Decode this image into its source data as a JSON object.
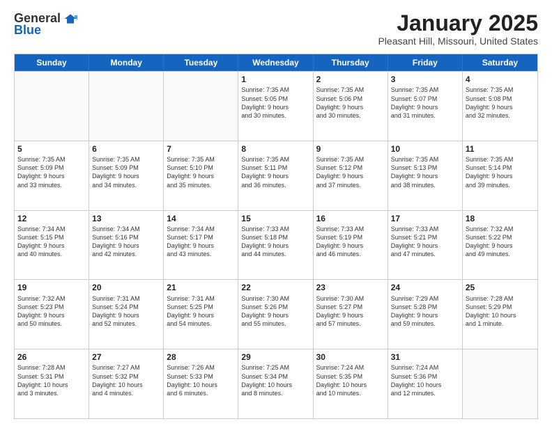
{
  "logo": {
    "general": "General",
    "blue": "Blue"
  },
  "title": "January 2025",
  "subtitle": "Pleasant Hill, Missouri, United States",
  "days": [
    "Sunday",
    "Monday",
    "Tuesday",
    "Wednesday",
    "Thursday",
    "Friday",
    "Saturday"
  ],
  "weeks": [
    [
      {
        "day": "",
        "info": "",
        "empty": true
      },
      {
        "day": "",
        "info": "",
        "empty": true
      },
      {
        "day": "",
        "info": "",
        "empty": true
      },
      {
        "day": "1",
        "info": "Sunrise: 7:35 AM\nSunset: 5:05 PM\nDaylight: 9 hours\nand 30 minutes."
      },
      {
        "day": "2",
        "info": "Sunrise: 7:35 AM\nSunset: 5:06 PM\nDaylight: 9 hours\nand 30 minutes."
      },
      {
        "day": "3",
        "info": "Sunrise: 7:35 AM\nSunset: 5:07 PM\nDaylight: 9 hours\nand 31 minutes."
      },
      {
        "day": "4",
        "info": "Sunrise: 7:35 AM\nSunset: 5:08 PM\nDaylight: 9 hours\nand 32 minutes."
      }
    ],
    [
      {
        "day": "5",
        "info": "Sunrise: 7:35 AM\nSunset: 5:09 PM\nDaylight: 9 hours\nand 33 minutes."
      },
      {
        "day": "6",
        "info": "Sunrise: 7:35 AM\nSunset: 5:09 PM\nDaylight: 9 hours\nand 34 minutes."
      },
      {
        "day": "7",
        "info": "Sunrise: 7:35 AM\nSunset: 5:10 PM\nDaylight: 9 hours\nand 35 minutes."
      },
      {
        "day": "8",
        "info": "Sunrise: 7:35 AM\nSunset: 5:11 PM\nDaylight: 9 hours\nand 36 minutes."
      },
      {
        "day": "9",
        "info": "Sunrise: 7:35 AM\nSunset: 5:12 PM\nDaylight: 9 hours\nand 37 minutes."
      },
      {
        "day": "10",
        "info": "Sunrise: 7:35 AM\nSunset: 5:13 PM\nDaylight: 9 hours\nand 38 minutes."
      },
      {
        "day": "11",
        "info": "Sunrise: 7:35 AM\nSunset: 5:14 PM\nDaylight: 9 hours\nand 39 minutes."
      }
    ],
    [
      {
        "day": "12",
        "info": "Sunrise: 7:34 AM\nSunset: 5:15 PM\nDaylight: 9 hours\nand 40 minutes."
      },
      {
        "day": "13",
        "info": "Sunrise: 7:34 AM\nSunset: 5:16 PM\nDaylight: 9 hours\nand 42 minutes."
      },
      {
        "day": "14",
        "info": "Sunrise: 7:34 AM\nSunset: 5:17 PM\nDaylight: 9 hours\nand 43 minutes."
      },
      {
        "day": "15",
        "info": "Sunrise: 7:33 AM\nSunset: 5:18 PM\nDaylight: 9 hours\nand 44 minutes."
      },
      {
        "day": "16",
        "info": "Sunrise: 7:33 AM\nSunset: 5:19 PM\nDaylight: 9 hours\nand 46 minutes."
      },
      {
        "day": "17",
        "info": "Sunrise: 7:33 AM\nSunset: 5:21 PM\nDaylight: 9 hours\nand 47 minutes."
      },
      {
        "day": "18",
        "info": "Sunrise: 7:32 AM\nSunset: 5:22 PM\nDaylight: 9 hours\nand 49 minutes."
      }
    ],
    [
      {
        "day": "19",
        "info": "Sunrise: 7:32 AM\nSunset: 5:23 PM\nDaylight: 9 hours\nand 50 minutes."
      },
      {
        "day": "20",
        "info": "Sunrise: 7:31 AM\nSunset: 5:24 PM\nDaylight: 9 hours\nand 52 minutes."
      },
      {
        "day": "21",
        "info": "Sunrise: 7:31 AM\nSunset: 5:25 PM\nDaylight: 9 hours\nand 54 minutes."
      },
      {
        "day": "22",
        "info": "Sunrise: 7:30 AM\nSunset: 5:26 PM\nDaylight: 9 hours\nand 55 minutes."
      },
      {
        "day": "23",
        "info": "Sunrise: 7:30 AM\nSunset: 5:27 PM\nDaylight: 9 hours\nand 57 minutes."
      },
      {
        "day": "24",
        "info": "Sunrise: 7:29 AM\nSunset: 5:28 PM\nDaylight: 9 hours\nand 59 minutes."
      },
      {
        "day": "25",
        "info": "Sunrise: 7:28 AM\nSunset: 5:29 PM\nDaylight: 10 hours\nand 1 minute."
      }
    ],
    [
      {
        "day": "26",
        "info": "Sunrise: 7:28 AM\nSunset: 5:31 PM\nDaylight: 10 hours\nand 3 minutes."
      },
      {
        "day": "27",
        "info": "Sunrise: 7:27 AM\nSunset: 5:32 PM\nDaylight: 10 hours\nand 4 minutes."
      },
      {
        "day": "28",
        "info": "Sunrise: 7:26 AM\nSunset: 5:33 PM\nDaylight: 10 hours\nand 6 minutes."
      },
      {
        "day": "29",
        "info": "Sunrise: 7:25 AM\nSunset: 5:34 PM\nDaylight: 10 hours\nand 8 minutes."
      },
      {
        "day": "30",
        "info": "Sunrise: 7:24 AM\nSunset: 5:35 PM\nDaylight: 10 hours\nand 10 minutes."
      },
      {
        "day": "31",
        "info": "Sunrise: 7:24 AM\nSunset: 5:36 PM\nDaylight: 10 hours\nand 12 minutes."
      },
      {
        "day": "",
        "info": "",
        "empty": true
      }
    ]
  ]
}
